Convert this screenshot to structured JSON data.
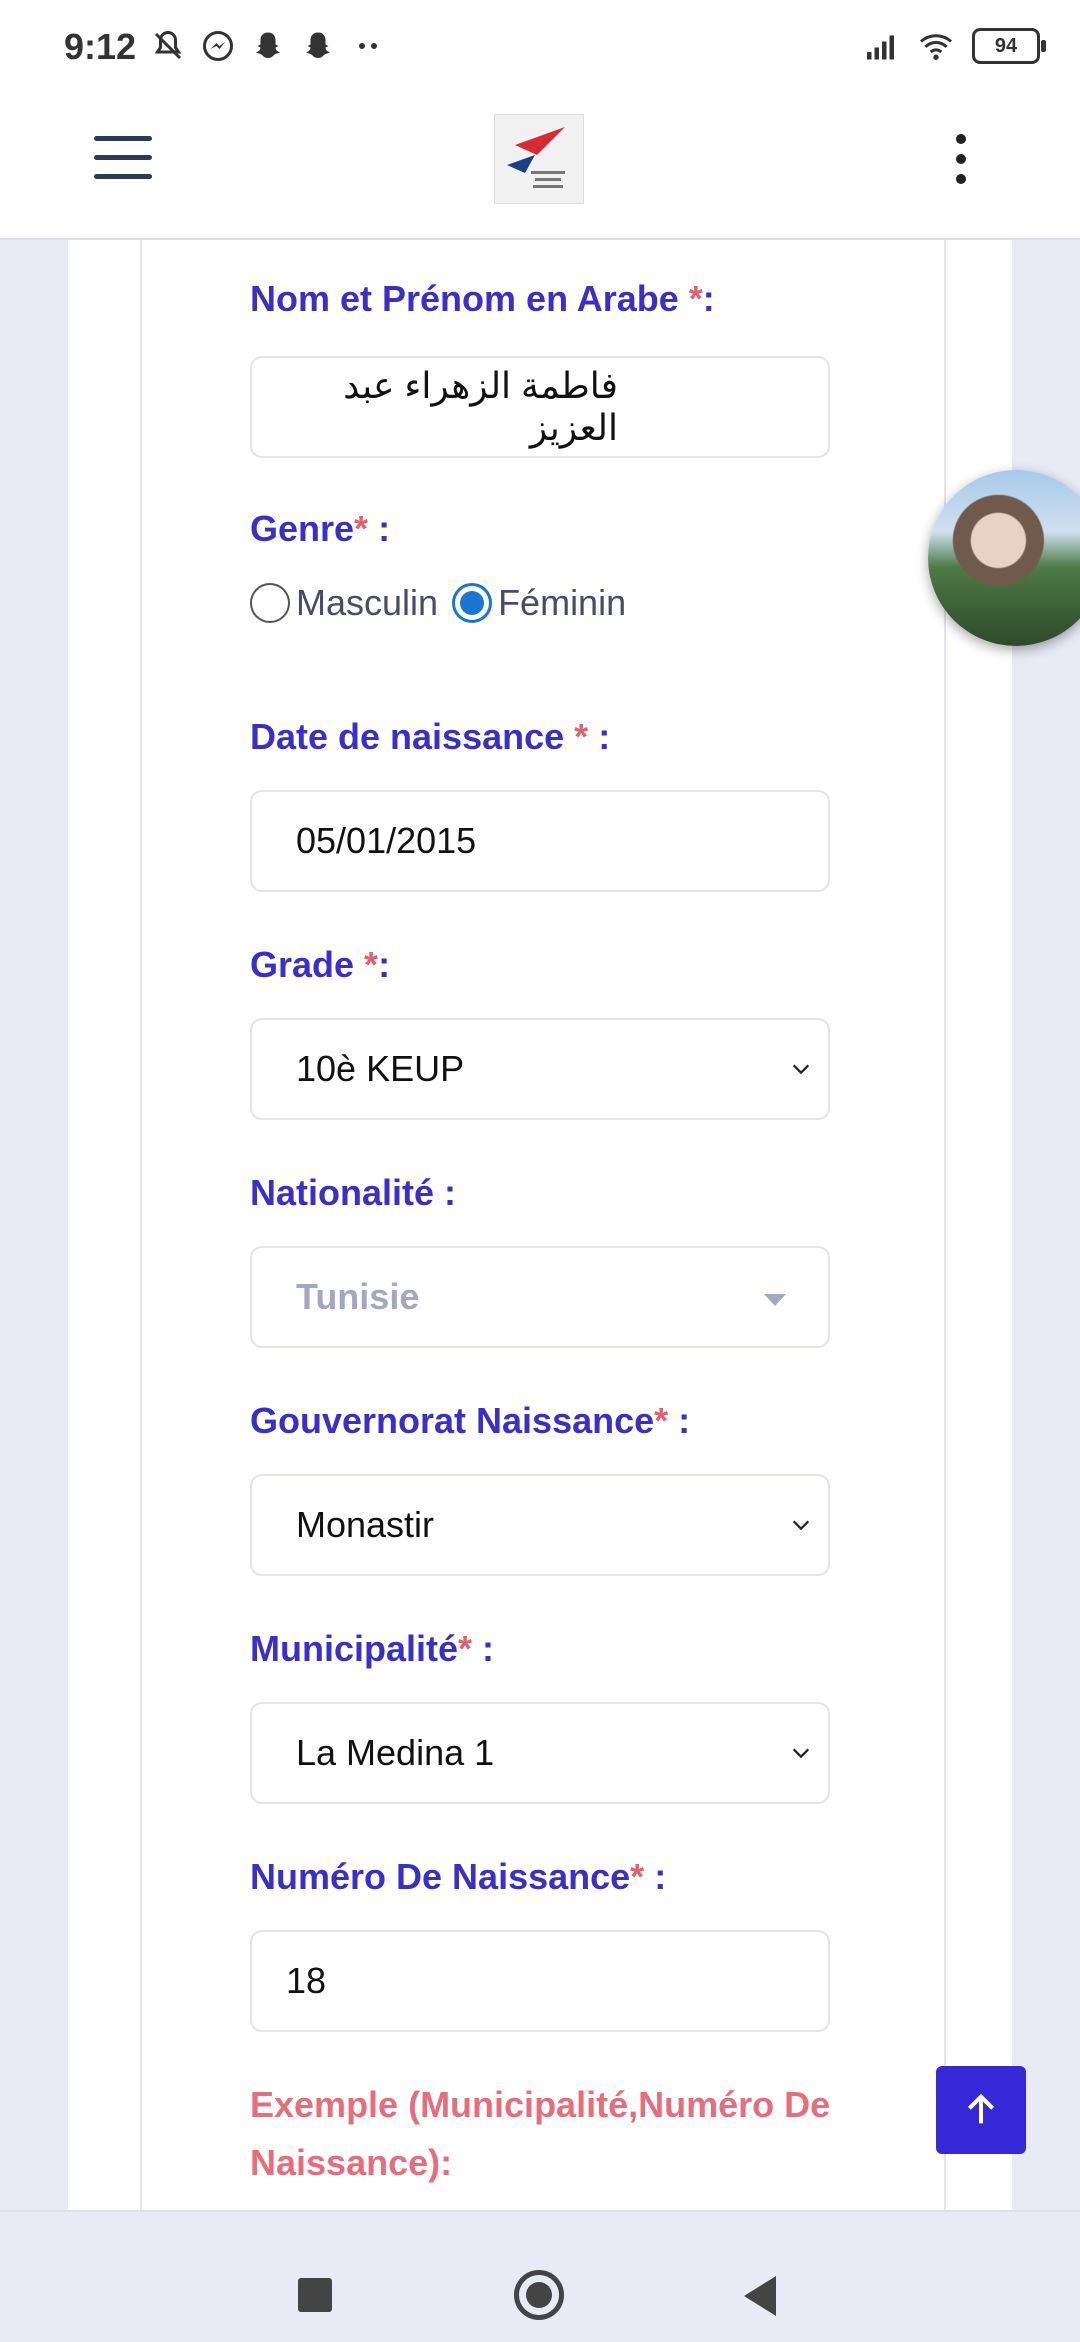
{
  "status_bar": {
    "time": "9:12",
    "battery": "94",
    "icons_left": [
      "mute-icon",
      "messenger-icon",
      "snapchat-icon",
      "snapchat-icon",
      "more-dots-icon"
    ],
    "icons_right": [
      "signal-icon",
      "wifi-icon",
      "battery-icon"
    ]
  },
  "app_bar": {
    "menu_icon": "hamburger-icon",
    "logo": "federation-logo",
    "overflow_icon": "kebab-icon"
  },
  "form": {
    "arabic_name": {
      "label": "Nom et Prénom en Arabe ",
      "required_mark": "*",
      "suffix": ":",
      "value": "فاطمة الزهراء عبد العزيز"
    },
    "gender": {
      "label": "Genre",
      "required_mark": "*",
      "suffix": " :",
      "options": [
        "Masculin",
        "Féminin"
      ],
      "selected": "Féminin"
    },
    "birth_date": {
      "label": "Date de naissance ",
      "required_mark": "*",
      "suffix": " :",
      "value": "05/01/2015"
    },
    "grade": {
      "label": "Grade ",
      "required_mark": "*",
      "suffix": ":",
      "value": "10è KEUP"
    },
    "nationality": {
      "label": "Nationalité :",
      "value": "Tunisie"
    },
    "birth_governorate": {
      "label": "Gouvernorat Naissance",
      "required_mark": "*",
      "suffix": " :",
      "value": "Monastir"
    },
    "municipality": {
      "label": "Municipalité",
      "required_mark": "*",
      "suffix": " :",
      "value": "La Medina 1"
    },
    "birth_number": {
      "label": "Numéro De Naissance",
      "required_mark": "*",
      "suffix": " :",
      "value": "18"
    },
    "example_text": "Exemple (Municipalité,Numéro De Naissance):"
  },
  "colors": {
    "label": "#3a2fc9",
    "required": "#e0606e",
    "radio_checked": "#1976d2",
    "scroll_button": "#3628d6"
  }
}
